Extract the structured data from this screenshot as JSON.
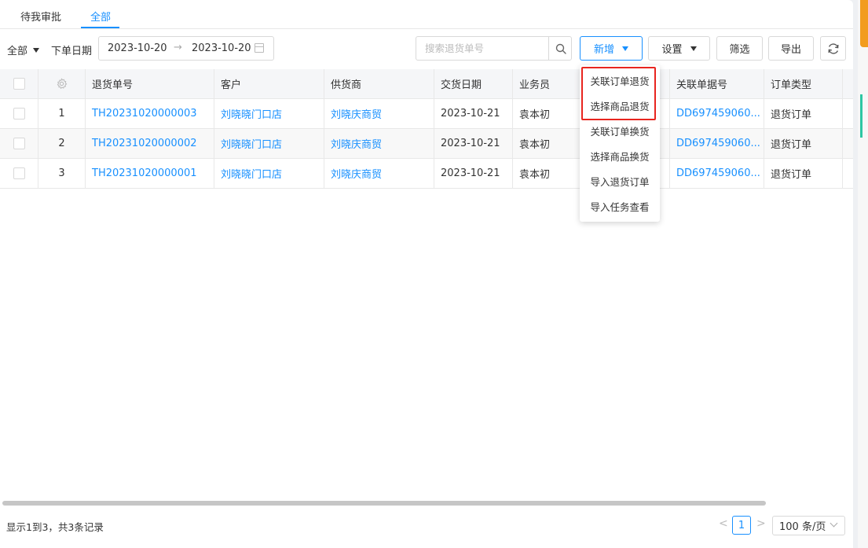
{
  "tabs": [
    {
      "label": "待我审批",
      "active": false
    },
    {
      "label": "全部",
      "active": true
    }
  ],
  "toolbar": {
    "scope_label": "全部",
    "date_label": "下单日期",
    "date_start": "2023-10-20",
    "date_sep": "→",
    "date_end": "2023-10-20",
    "search_placeholder": "搜索退货单号",
    "add_label": "新增",
    "settings_label": "设置",
    "filter_label": "筛选",
    "export_label": "导出"
  },
  "table": {
    "headers": [
      "退货单号",
      "客户",
      "供货商",
      "交货日期",
      "业务员",
      "关联单据号",
      "订单类型"
    ],
    "rows": [
      {
        "index": "1",
        "order_no": "TH20231020000003",
        "customer": "刘晓晓门口店",
        "supplier": "刘晓庆商贸",
        "delivery_date": "2023-10-21",
        "salesman": "袁本初",
        "related_no": "DD697459060...",
        "order_type": "退货订单"
      },
      {
        "index": "2",
        "order_no": "TH20231020000002",
        "customer": "刘晓晓门口店",
        "supplier": "刘晓庆商贸",
        "delivery_date": "2023-10-21",
        "salesman": "袁本初",
        "related_no": "DD697459060...",
        "order_type": "退货订单"
      },
      {
        "index": "3",
        "order_no": "TH20231020000001",
        "customer": "刘晓晓门口店",
        "supplier": "刘晓庆商贸",
        "delivery_date": "2023-10-21",
        "salesman": "袁本初",
        "related_no": "DD697459060...",
        "order_type": "退货订单"
      }
    ]
  },
  "dropdown": {
    "items": [
      "关联订单退货",
      "选择商品退货",
      "关联订单换货",
      "选择商品换货",
      "导入退货订单",
      "导入任务查看"
    ]
  },
  "footer": {
    "summary": "显示1到3，共3条记录",
    "prev": "<",
    "current_page": "1",
    "next": ">",
    "page_size": "100 条/页"
  },
  "colors": {
    "accent": "#1890ff",
    "highlight": "#e8251f"
  }
}
